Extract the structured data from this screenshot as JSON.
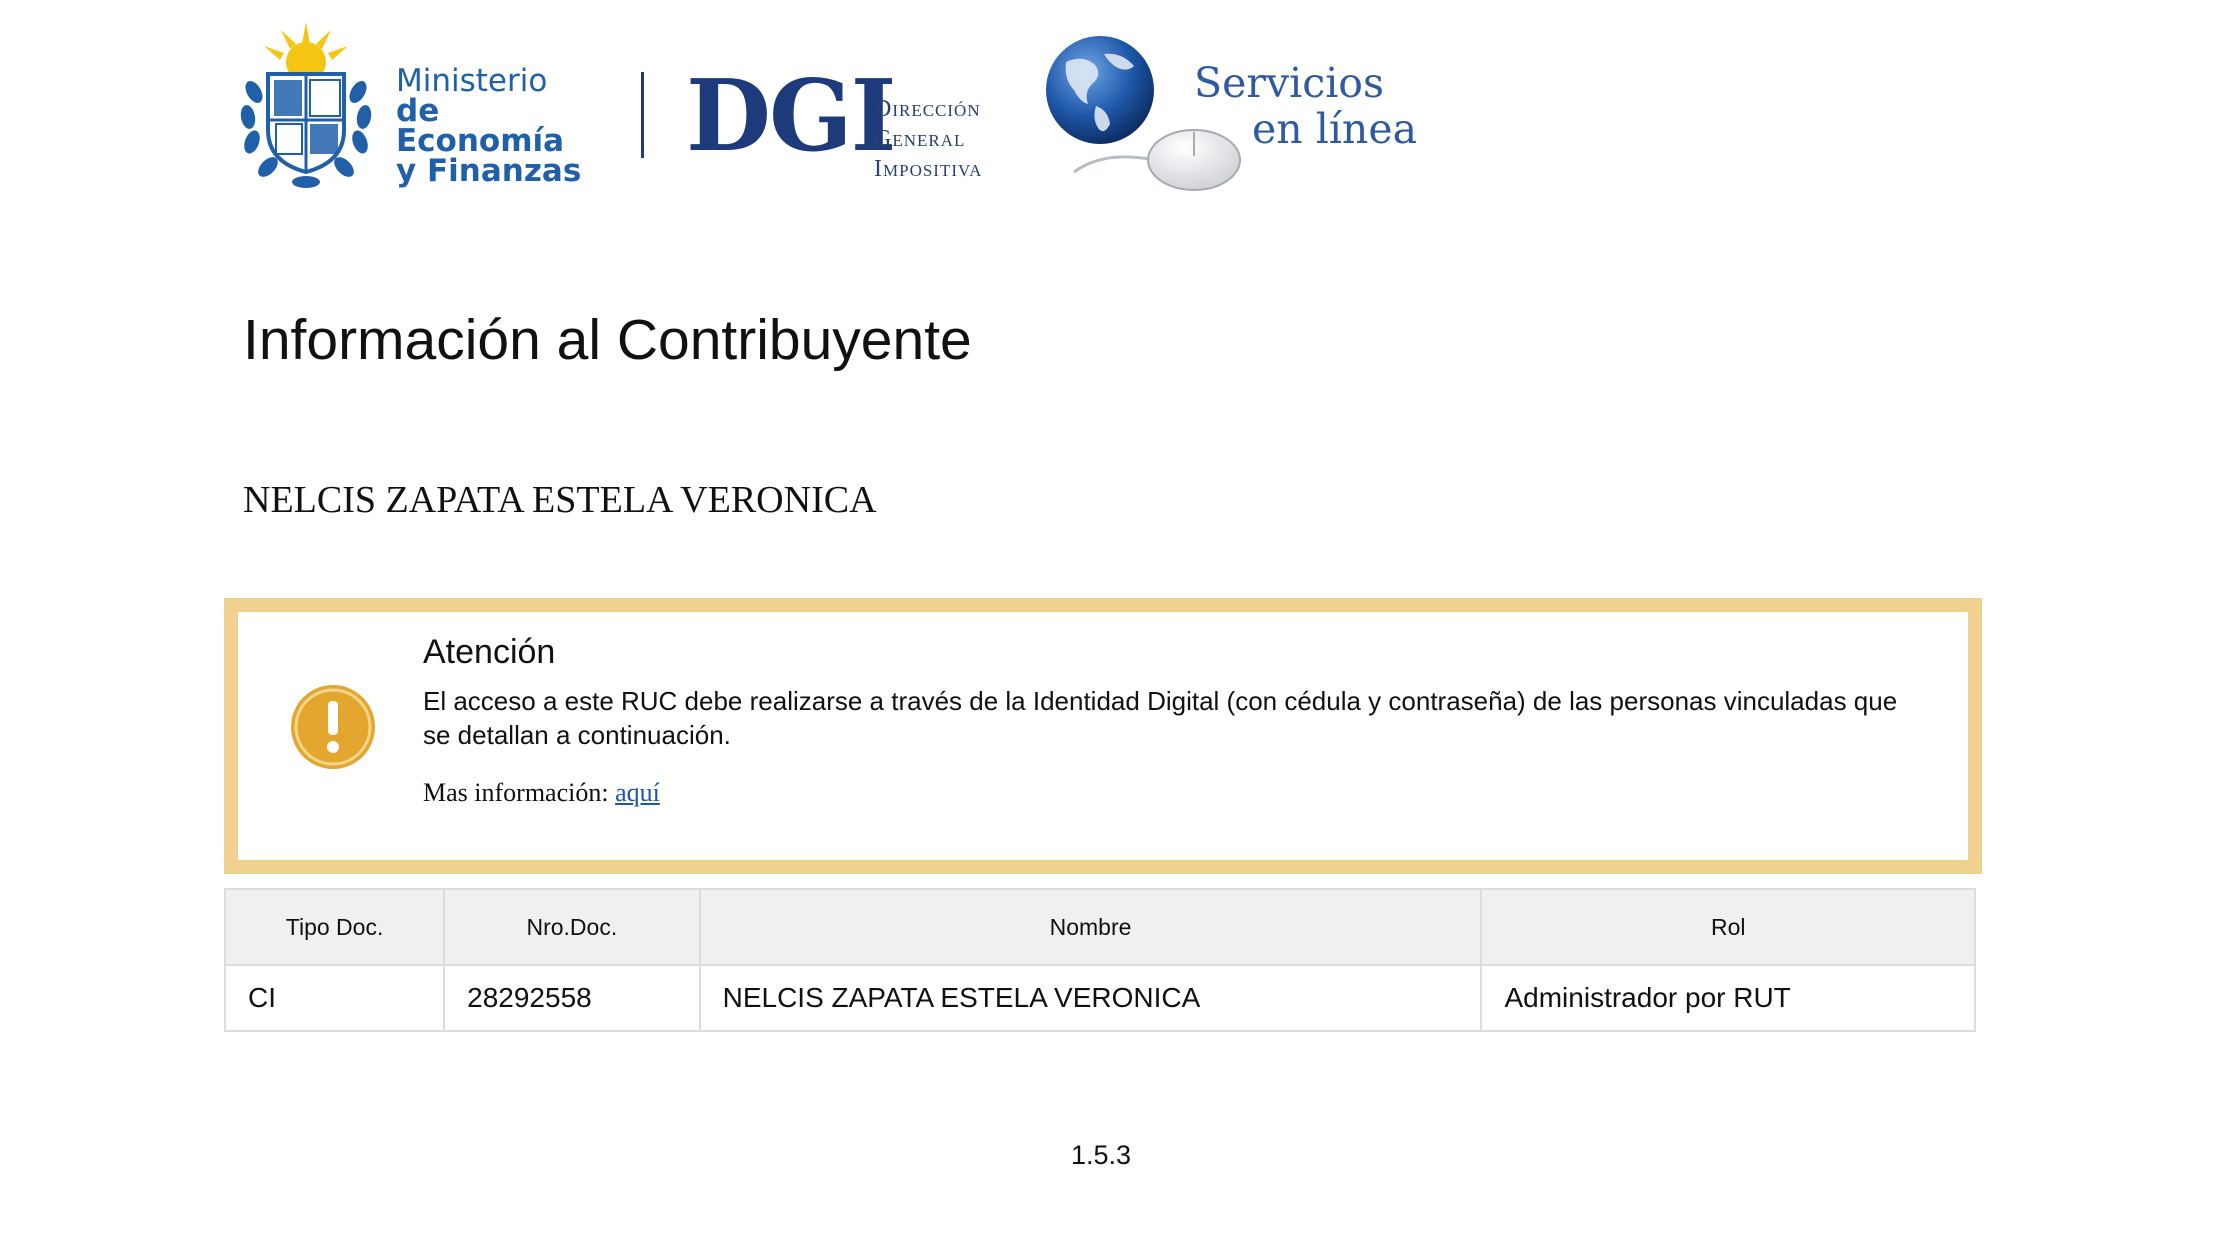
{
  "header": {
    "mef": {
      "line1": "Ministerio",
      "line2": "de Economía",
      "line3": "y Finanzas"
    },
    "dgi": {
      "letters": "DGI",
      "line1": "Dirección",
      "line2": "General",
      "line3": "Impositiva"
    },
    "servicios": {
      "line1": "Servicios",
      "line2": "en línea"
    }
  },
  "page_title": "Información al Contribuyente",
  "taxpayer_name": "NELCIS ZAPATA ESTELA VERONICA",
  "attention": {
    "title": "Atención",
    "body": "El acceso a este RUC debe realizarse a través de la Identidad Digital (con cédula y contraseña) de las personas vinculadas que se detallan a continuación.",
    "more_label": "Mas información:",
    "more_link": "aquí",
    "icon": "warning-icon",
    "accent_color": "#efd08e",
    "icon_color": "#e3a72f"
  },
  "table": {
    "headers": {
      "tipo": "Tipo Doc.",
      "nro": "Nro.Doc.",
      "nombre": "Nombre",
      "rol": "Rol"
    },
    "rows": [
      {
        "tipo": "CI",
        "nro": "28292558",
        "nombre": "NELCIS ZAPATA ESTELA VERONICA",
        "rol": "Administrador por RUT"
      }
    ]
  },
  "footer": {
    "version": "1.5.3"
  }
}
